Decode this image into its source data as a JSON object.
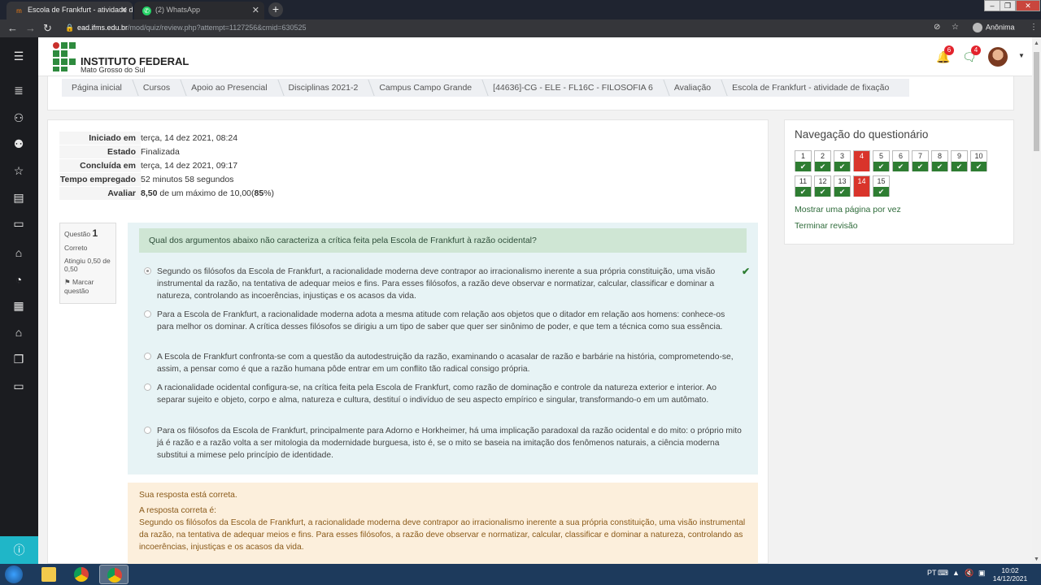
{
  "browser": {
    "tabs": [
      {
        "title": "Escola de Frankfurt - atividade d",
        "active": true
      },
      {
        "title": "(2) WhatsApp",
        "active": false
      }
    ],
    "url_host": "ead.ifms.edu.br",
    "url_path": "/mod/quiz/review.php?attempt=1127256&cmid=630525",
    "profile_label": "Anônima"
  },
  "header": {
    "logo_title": "INSTITUTO FEDERAL",
    "logo_subtitle": "Mato Grosso do Sul",
    "notifications_count": "6",
    "messages_count": "4"
  },
  "breadcrumb": [
    "Página inicial",
    "Cursos",
    "Apoio ao Presencial",
    "Disciplinas 2021-2",
    "Campus Campo Grande",
    "[44636]-CG - ELE - FL16C - FILOSOFIA 6",
    "Avaliação",
    "Escola de Frankfurt - atividade de fixação"
  ],
  "summary": [
    {
      "label": "Iniciado em",
      "value": "terça, 14 dez 2021, 08:24"
    },
    {
      "label": "Estado",
      "value": "Finalizada"
    },
    {
      "label": "Concluída em",
      "value": "terça, 14 dez 2021, 09:17"
    },
    {
      "label": "Tempo empregado",
      "value": "52 minutos 58 segundos"
    },
    {
      "label": "Avaliar",
      "value_strong": "8,50",
      "value_mid": " de um máximo de 10,00(",
      "value_pct": "85",
      "value_end": "%)"
    }
  ],
  "question_info": {
    "label": "Questão",
    "number": "1",
    "state": "Correto",
    "grade": "Atingiu 0,50 de 0,50",
    "flag_label": "Marcar questão"
  },
  "question": {
    "text": "Qual dos argumentos abaixo não caracteriza a crítica feita pela Escola de Frankfurt à razão ocidental?",
    "answers": [
      {
        "text": "Segundo os filósofos da Escola de Frankfurt, a racionalidade moderna deve contrapor ao irracionalismo inerente a sua própria constituição, uma visão instrumental da razão, na tentativa de adequar meios e fins. Para esses filósofos, a razão deve observar e normatizar, calcular, classificar e dominar a natureza, controlando as incoerências, injustiças e os acasos da vida.",
        "selected": true,
        "correct": true
      },
      {
        "text": "Para a Escola de Frankfurt, a racionalidade moderna adota a mesma atitude com relação aos objetos que o ditador em relação aos homens: conhece-os para melhor os dominar. A crítica desses filósofos se dirigiu a um tipo de saber que quer ser sinônimo de poder, e que tem a técnica como sua essência.",
        "selected": false
      },
      {
        "text": "A Escola de Frankfurt confronta-se com a questão da autodestruição da razão, examinando o acasalar de razão e barbárie na história, comprometendo-se, assim, a pensar como é que a razão humana pôde entrar em um conflito tão radical consigo própria.",
        "selected": false
      },
      {
        "text": "A racionalidade ocidental configura-se, na crítica feita pela Escola de Frankfurt, como razão de dominação e controle da natureza exterior e interior. Ao separar sujeito e objeto, corpo e alma, natureza e cultura, destituí o indivíduo de seu aspecto empírico e singular, transformando-o em um autômato.",
        "selected": false
      },
      {
        "text": "Para os filósofos da Escola de Frankfurt, principalmente para Adorno e Horkheimer, há uma implicação paradoxal da razão ocidental e do mito: o próprio mito já é razão e a razão volta a ser mitologia da modernidade burguesa, isto é, se o mito se baseia na imitação dos fenômenos naturais, a ciência moderna substitui a mimese pelo princípio de identidade.",
        "selected": false
      }
    ]
  },
  "feedback": {
    "status": "Sua resposta está correta.",
    "correct_label": "A resposta correta é:",
    "correct_text": "Segundo os filósofos da Escola de Frankfurt, a racionalidade moderna deve contrapor ao irracionalismo inerente a sua própria constituição, uma visão instrumental da razão, na tentativa de adequar meios e fins. Para esses filósofos, a razão deve observar e normatizar, calcular, classificar e dominar a natureza, controlando as incoerências, injustiças e os acasos da vida."
  },
  "quiz_nav": {
    "title": "Navegação do questionário",
    "questions": [
      {
        "n": "1",
        "state": "correct"
      },
      {
        "n": "2",
        "state": "correct"
      },
      {
        "n": "3",
        "state": "correct"
      },
      {
        "n": "4",
        "state": "incorrect"
      },
      {
        "n": "5",
        "state": "correct"
      },
      {
        "n": "6",
        "state": "correct"
      },
      {
        "n": "7",
        "state": "correct"
      },
      {
        "n": "8",
        "state": "correct"
      },
      {
        "n": "9",
        "state": "correct"
      },
      {
        "n": "10",
        "state": "correct"
      },
      {
        "n": "11",
        "state": "correct"
      },
      {
        "n": "12",
        "state": "correct"
      },
      {
        "n": "13",
        "state": "correct"
      },
      {
        "n": "14",
        "state": "incorrect"
      },
      {
        "n": "15",
        "state": "correct"
      }
    ],
    "link_one_page": "Mostrar uma página por vez",
    "link_finish": "Terminar revisão"
  },
  "taskbar": {
    "lang": "PT",
    "time": "10:02",
    "date": "14/12/2021"
  },
  "colors": {
    "brand_green": "#2e8b3e",
    "correct_green": "#2e7d32",
    "incorrect_red": "#d9342b"
  }
}
